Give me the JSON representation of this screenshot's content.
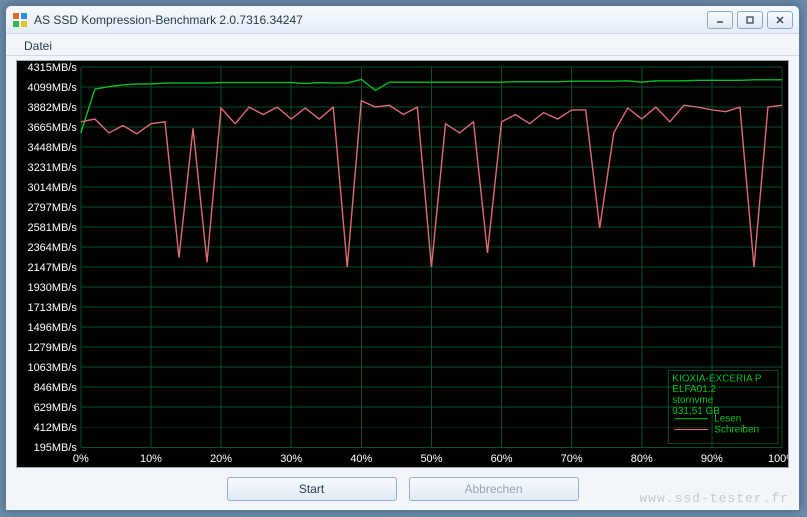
{
  "window": {
    "title": "AS SSD Kompression-Benchmark 2.0.7316.34247"
  },
  "menubar": {
    "datei": "Datei"
  },
  "buttons": {
    "start": "Start",
    "abbrechen": "Abbrechen"
  },
  "legend": {
    "device": "KIOXIA-EXCERIA P",
    "firmware": "ELFA01.2",
    "driver": "stornvme",
    "capacity": "931,51 GB",
    "read": "Lesen",
    "write": "Schreiben"
  },
  "watermark": "www.ssd-tester.fr",
  "chart_data": {
    "type": "line",
    "title": "",
    "xlabel": "",
    "ylabel": "",
    "x_unit": "%",
    "y_unit": "MB/s",
    "xlim": [
      0,
      100
    ],
    "ylim": [
      195,
      4315
    ],
    "y_ticks": [
      195,
      412,
      629,
      846,
      1063,
      1279,
      1496,
      1713,
      1930,
      2147,
      2364,
      2581,
      2797,
      3014,
      3231,
      3448,
      3665,
      3882,
      4099,
      4315
    ],
    "y_tick_labels": [
      "195MB/s",
      "412MB/s",
      "629MB/s",
      "846MB/s",
      "1063MB/s",
      "1279MB/s",
      "1496MB/s",
      "1713MB/s",
      "1930MB/s",
      "2147MB/s",
      "2364MB/s",
      "2581MB/s",
      "2797MB/s",
      "3014MB/s",
      "3231MB/s",
      "3448MB/s",
      "3665MB/s",
      "3882MB/s",
      "4099MB/s",
      "4315MB/s"
    ],
    "x_ticks": [
      0,
      10,
      20,
      30,
      40,
      50,
      60,
      70,
      80,
      90,
      100
    ],
    "x_tick_labels": [
      "0%",
      "10%",
      "20%",
      "30%",
      "40%",
      "50%",
      "60%",
      "70%",
      "80%",
      "90%",
      "100%"
    ],
    "series": [
      {
        "name": "Lesen",
        "color": "#00c224",
        "x": [
          0,
          2,
          4,
          6,
          8,
          10,
          12,
          14,
          16,
          18,
          20,
          22,
          24,
          26,
          28,
          30,
          32,
          34,
          36,
          38,
          40,
          42,
          44,
          46,
          48,
          50,
          52,
          54,
          56,
          58,
          60,
          62,
          64,
          66,
          68,
          70,
          72,
          74,
          76,
          78,
          80,
          82,
          84,
          86,
          88,
          90,
          92,
          94,
          96,
          98,
          100
        ],
        "y": [
          3600,
          4075,
          4100,
          4120,
          4130,
          4130,
          4140,
          4140,
          4140,
          4140,
          4145,
          4145,
          4145,
          4145,
          4145,
          4145,
          4135,
          4145,
          4140,
          4140,
          4180,
          4060,
          4150,
          4150,
          4150,
          4150,
          4150,
          4150,
          4150,
          4150,
          4150,
          4155,
          4155,
          4155,
          4155,
          4160,
          4160,
          4160,
          4160,
          4165,
          4150,
          4165,
          4165,
          4165,
          4170,
          4170,
          4170,
          4170,
          4175,
          4175,
          4175
        ]
      },
      {
        "name": "Schreiben",
        "color": "#df6b74",
        "x": [
          0,
          2,
          4,
          6,
          8,
          10,
          12,
          14,
          16,
          18,
          20,
          22,
          24,
          26,
          28,
          30,
          32,
          34,
          36,
          38,
          40,
          42,
          44,
          46,
          48,
          50,
          52,
          54,
          56,
          58,
          60,
          62,
          64,
          66,
          68,
          70,
          72,
          74,
          76,
          78,
          80,
          82,
          84,
          86,
          88,
          90,
          92,
          94,
          96,
          98,
          100
        ],
        "y": [
          3720,
          3750,
          3600,
          3680,
          3590,
          3700,
          3720,
          2250,
          3650,
          2200,
          3870,
          3700,
          3880,
          3800,
          3880,
          3750,
          3870,
          3750,
          3880,
          2147,
          3950,
          3880,
          3900,
          3800,
          3880,
          2147,
          3700,
          3600,
          3720,
          2300,
          3720,
          3800,
          3700,
          3820,
          3750,
          3850,
          3850,
          2570,
          3600,
          3870,
          3750,
          3880,
          3720,
          3900,
          3880,
          3850,
          3830,
          3880,
          2147,
          3880,
          3900
        ]
      }
    ]
  }
}
